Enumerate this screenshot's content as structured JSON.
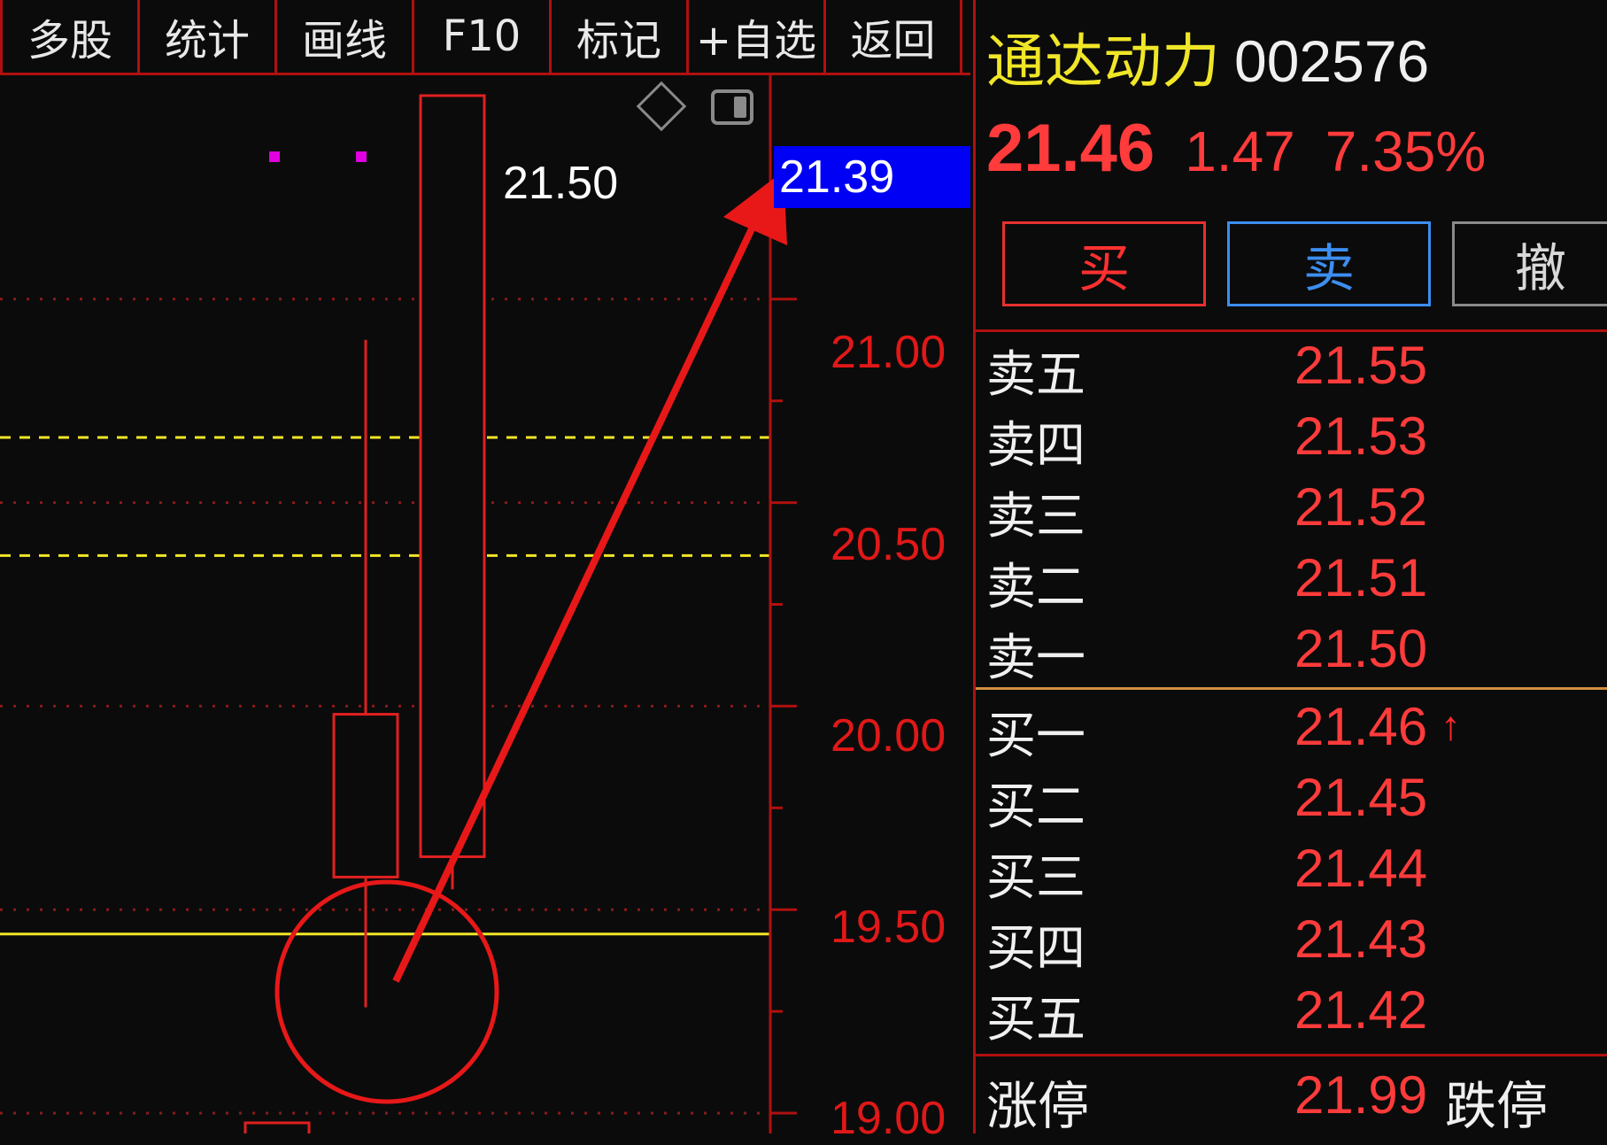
{
  "toolbar": {
    "buttons": [
      {
        "label": "多股"
      },
      {
        "label": "统计"
      },
      {
        "label": "画线"
      },
      {
        "label": "F10"
      },
      {
        "label": "标记"
      },
      {
        "label": "+自选"
      },
      {
        "label": "返回"
      }
    ]
  },
  "chart": {
    "current_price_tag": "21.39",
    "high_label": "21.50",
    "y_ticks": [
      "21.00",
      "20.50",
      "20.00",
      "19.50",
      "19.00"
    ],
    "colors": {
      "up": "#e02020",
      "support_line": "#f0e628",
      "grid": "#8a1a1a",
      "annotation": "#e81818",
      "price_tag_bg": "#0000f5"
    }
  },
  "chart_data": {
    "type": "candlestick",
    "ylim": [
      18.95,
      21.55
    ],
    "ticks": [
      19.0,
      19.5,
      20.0,
      20.5,
      21.0
    ],
    "candles": [
      {
        "open": 19.58,
        "close": 19.98,
        "high": 20.9,
        "low": 19.26
      },
      {
        "open": 19.63,
        "close": 21.5,
        "high": 21.5,
        "low": 19.55
      }
    ],
    "horizontal_lines": [
      {
        "price": 20.66,
        "style": "dashed",
        "color": "#f0e628"
      },
      {
        "price": 20.37,
        "style": "dashed",
        "color": "#f0e628"
      },
      {
        "price": 19.44,
        "style": "solid",
        "color": "#f0e628"
      }
    ]
  },
  "stock": {
    "name": "通达动力",
    "code": "002576",
    "price": "21.46",
    "change": "1.47",
    "change_pct": "7.35%"
  },
  "trade_buttons": {
    "buy": "买",
    "sell": "卖",
    "cancel": "撤"
  },
  "order_book": {
    "asks": [
      {
        "label": "卖五",
        "price": "21.55"
      },
      {
        "label": "卖四",
        "price": "21.53"
      },
      {
        "label": "卖三",
        "price": "21.52"
      },
      {
        "label": "卖二",
        "price": "21.51"
      },
      {
        "label": "卖一",
        "price": "21.50"
      }
    ],
    "bids": [
      {
        "label": "买一",
        "price": "21.46",
        "arrow": "↑"
      },
      {
        "label": "买二",
        "price": "21.45"
      },
      {
        "label": "买三",
        "price": "21.44"
      },
      {
        "label": "买四",
        "price": "21.43"
      },
      {
        "label": "买五",
        "price": "21.42"
      }
    ]
  },
  "limits": {
    "up_label": "涨停",
    "up_price": "21.99",
    "down_label": "跌停"
  }
}
